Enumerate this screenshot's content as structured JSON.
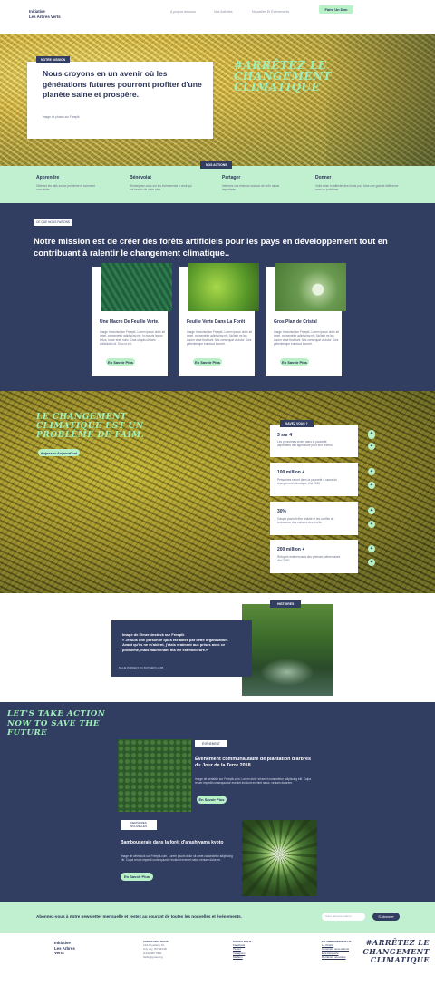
{
  "header": {
    "logo_line1": "Initiative",
    "logo_line2": "Les Arbres Verts",
    "nav": [
      "A propos de nous",
      "Nos Activités",
      "Nouvelles Et Événements"
    ],
    "cta": "Faire Un Don"
  },
  "hero": {
    "badge": "NOTRE MISSION",
    "headline": "Nous croyons en un avenir où les générations futures pourront profiter d'une planète saine et prospère.",
    "credit": "Image de photos sur Freepik",
    "slogan": "#ARRÊTEZ LE CHANGEMENT CLIMATIQUE"
  },
  "actions": {
    "badge": "NOS ACTIONS",
    "items": [
      {
        "title": "Apprendre",
        "text": "Obtenez les faits sur ce problème et comment vous aider."
      },
      {
        "title": "Bénévolat",
        "text": "Renseignez-vous sur les événements à venir qui ont besoin de votre aide."
      },
      {
        "title": "Partager",
        "text": "Informez vos réseaux sociaux de ce'le cause importante."
      },
      {
        "title": "Donner",
        "text": "Votre mise à l'affecter des fonds pour faire une grande différence avec ce problème."
      }
    ]
  },
  "mission": {
    "badge": "CE QUE NOUS FAISONS",
    "headline": "Notre mission est de créer des forêts artificiels pour les pays en développement tout en contribuant à ralentir le changement climatique..",
    "cards": [
      {
        "title": "Une Macro De Feuille Verte.",
        "text": "Image Vectorisé sur Freepik. Lorem ipsum dolor sit amet, consectetur adipiscing elit. In mauris lectus tellus, fusce erat, nunc. Cras ut quis ultrices sollicitudin id. Odio ut elit.",
        "button": "En Savoir Plus"
      },
      {
        "title": "Feuille Verte Dans La Forêt",
        "text": "Image Vectorisé sur Freepik. Lorem ipsum dolor sit amet, consectetur adipiscing elit. Nullam mi leo, auctor vitae tincidunt. Nisi consequat ut dolor. Duis pellentesque euismod laoreet.",
        "button": "En Savoir Plus"
      },
      {
        "title": "Gros Plan de Cristal",
        "text": "Image Vectorisé sur Freepik. Lorem ipsum dolor sit amet, consectetur adipiscing elit. Nullam mi leo, auctor vitae tincidunt. Nisi consequat ut dolor. Duis pellentesque euismod laoreet.",
        "button": "En Savoir Plus"
      }
    ]
  },
  "facts": {
    "headline": "LE CHANGEMENT CLIMATIQUE EST UN PROBLÈME DE FAIM.",
    "button": "Aujessez Aujourd'hui",
    "badge": "SAVEZ VOUS ?",
    "items": [
      {
        "title": "3 sur 4",
        "text": "Les personnes vivent dans la pauvreté dépendent de l'agriculture pour leur revenu."
      },
      {
        "title": "100 million +",
        "text": "Personnes seront dans la pauvreté à cause du changement climatique d'ici 2030."
      },
      {
        "title": "30%",
        "text": "Gaspis pourrait être réduite et les conflits de croissance des cultures des forêts."
      },
      {
        "title": "200 million +",
        "text": "Refugiés estimerons-à des phénom. alimentaires d'ici 2050."
      }
    ]
  },
  "story": {
    "badge": "HISTOIRES",
    "source": "Image de Elmersinstock sur Freepik",
    "quote": "« Je suis une personne qui a été aidée par cette organisation. Avant qu'ils ne m'aident, j'étais vraiment aux prises avec ce problème, mais maintenant ma vie est meilleure.»",
    "author": "BILLIE PARKER FOU BOTHERS 14/88"
  },
  "events": {
    "headline": "LET'S TAKE ACTION NOW TO SAVE THE FUTURE",
    "items": [
      {
        "badge": "ÉVÉNEMENT",
        "title": "Événement communautaire de plantation d'arbres du Jour de la Terre 2018",
        "text": "Image de aerialsin sur Freepik.com. Lorem dolor sit amet consectetur adipiscing elit. Culpa rerum impedit consequuntur eveniet incidunt eveniet natus, veniam dolorem.",
        "button": "En Savoir Plus"
      },
      {
        "badge": "DERNIÈRES NOUVELLES",
        "title": "Bambouseraie dans la forêt d'arashiyama kyoto",
        "text": "Image de wirestock sur Freepik.com. Lorem ipsum dolor sit amet consectetur adipiscing elit. Culpa rerum impedit consequuntur incidunt eveniet natus veniam dolorem.",
        "button": "En Savoir Plus"
      }
    ]
  },
  "newsletter": {
    "text": "Abonnez-vous à notre newsletter mensuelle et restez au courant de toutes les nouvelles et événements.",
    "placeholder": "Votre adresse mail ici",
    "button": "S'Abonner"
  },
  "footer": {
    "logo": [
      "Initiative",
      "Les Arbres",
      "Verts"
    ],
    "contact_title": "CONTACTEZ NOUS",
    "contact": [
      "123 Anywhere St.",
      "Any city, WY 11018",
      "(123) 456 7890",
      "hello@gmail.org"
    ],
    "social_title": "SUIVEZ-NOUS",
    "social": [
      "Facebook",
      "Twitter",
      "Instagram",
      "Medium"
    ],
    "links_title": "EN APPRENDRE PLUS",
    "links": [
      "La Charte",
      "Comment nous aidons",
      "Être bénévole",
      "Dernières nouvelles"
    ],
    "slogan": "#ARRÊTEZ LE CHANGEMENT CLIMATIQUE"
  }
}
